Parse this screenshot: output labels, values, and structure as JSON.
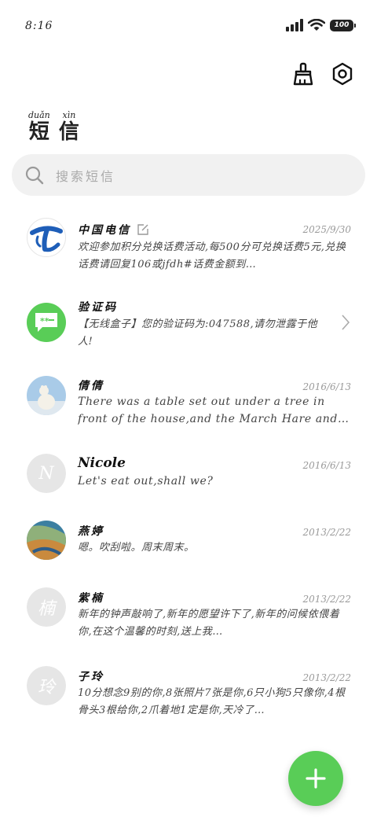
{
  "status_bar": {
    "time": "8:16",
    "battery": "100"
  },
  "header": {
    "title_pinyin": [
      "duǎn",
      "xìn"
    ],
    "title_chars": [
      "短",
      "信"
    ],
    "clean_icon": "broom-icon",
    "settings_icon": "hexagon-settings-icon"
  },
  "search": {
    "placeholder": "搜索短信",
    "icon": "search-icon"
  },
  "messages": [
    {
      "sender": "中国电信",
      "date": "2025/9/30",
      "preview": "欢迎参加积分兑换话费活动,每500分可兑换话费5元,兑换话费请回复106或jfdh#话费金额到…",
      "avatar": "china-telecom-logo",
      "has_edit_icon": true
    },
    {
      "sender": "验证码",
      "date": "",
      "preview": "【无线盒子】您的验证码为:047588,请勿泄露于他人!",
      "avatar": "sms-bubble"
    },
    {
      "sender": "倩倩",
      "date": "2016/6/13",
      "preview": "There was a table set out under a tree in front of the house,and the March Hare and t…",
      "avatar": "polar-bear-photo"
    },
    {
      "sender": "Nicole",
      "date": "2016/6/13",
      "preview": "Let's eat out,shall we?",
      "avatar_letter": "N"
    },
    {
      "sender": "燕婷",
      "date": "2013/2/22",
      "preview": "嗯。吹刮啦。周末周末。",
      "avatar": "landscape-photo"
    },
    {
      "sender": "紫楠",
      "date": "2013/2/22",
      "preview": "新年的钟声敲响了,新年的愿望许下了,新年的问候依偎着你,在这个温馨的时刻,送上我…",
      "avatar_letter": "楠"
    },
    {
      "sender": "子玲",
      "date": "2013/2/22",
      "preview": "10分想念9别的你,8张照片7张是你,6只小狗5只像你,4根骨头3根给你,2爪着地1定是你,天冷了…",
      "avatar_letter": "玲"
    }
  ],
  "fab": {
    "icon": "plus-icon"
  },
  "colors": {
    "accent": "#59cd57",
    "telecom_blue": "#1e5eb8"
  }
}
